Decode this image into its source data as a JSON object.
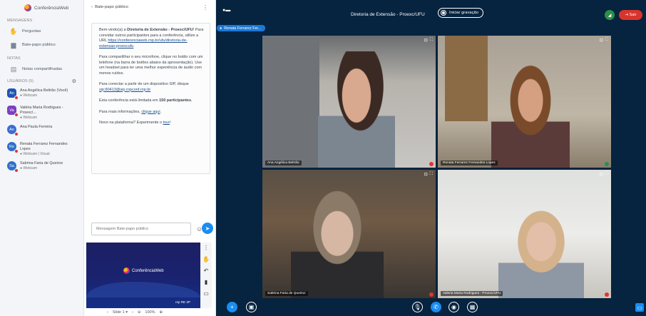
{
  "brand": {
    "name": "ConferênciaWeb"
  },
  "sidebar": {
    "messages_title": "MENSAGENS",
    "items": [
      {
        "label": "Perguntas",
        "icon": "hand-icon"
      },
      {
        "label": "Bate-papo público",
        "icon": "chat-icon"
      }
    ],
    "notes_title": "NOTAS",
    "notes_item": "Notas compartilhadas",
    "users_title": "USUÁRIOS (5)",
    "users": [
      {
        "initials": "An",
        "name": "Ana Angélica Beltrão (Você)",
        "status": "● Webcam",
        "color": "#1f55b4",
        "shape": "square"
      },
      {
        "initials": "Va",
        "name": "Valéria Maria Rodrigues - Proexc/...",
        "status": "● Webcam",
        "color": "#7b3fc1",
        "shape": "square"
      },
      {
        "initials": "An",
        "name": "Ana Paula Ferreira",
        "status": "",
        "color": "#3b6bd1",
        "shape": "round"
      },
      {
        "initials": "Re",
        "name": "Renata Ferrarez Fernandes Lopes",
        "status": "● Webcam | Visual",
        "color": "#2f6fc9",
        "shape": "round"
      },
      {
        "initials": "Sa",
        "name": "Sabrina Faria de Queiroz",
        "status": "● Webcam",
        "color": "#2f6fc9",
        "shape": "round"
      }
    ]
  },
  "chat": {
    "title": "Bate-papo público",
    "p1_a": "Bem-vindo(a) a ",
    "p1_b": "Diretoria de Extensão - Proexc/UFU",
    "p1_c": "! Para convidar outros participantes para a conferência, utilize a URL",
    "p1_link": "https://conferenciaweb.rnp.br/ufu/diretoria-de-extensao-proexcufu",
    "p2": "Para compartilhar o seu microfone, clique no botão com um telefone (na barra de botões abaixo da apresentação). Use um headset para ter uma melhor experiência de áudio com menos ruídos.",
    "p3_a": "Para conectar a partir de um dispositivo SIP, disque ",
    "p3_link": "sip:80413@sip.rnpconf.rnp.br",
    "p4_a": "Esta conferência está limitada em ",
    "p4_b": "150 participantes",
    "p4_c": ".",
    "p5_a": "Para mais informações, ",
    "p5_link": "clique aqui",
    "p5_c": ".",
    "p6_a": "Novo na plataforma? Experimente o ",
    "p6_link": "tour",
    "p6_c": "!",
    "input_placeholder": "Mensagem Bate-papo público"
  },
  "presentation": {
    "slide_logo_text": "ConferênciaWeb",
    "slide_footer": "rnp   RE·2P",
    "slide_label": "Slide 1",
    "zoom": "100%"
  },
  "main": {
    "conference_title": "Diretoria de Extensão - Proexc/UFU",
    "record_label": "Iniciar gravação",
    "leave_label": "Sair",
    "presenter": "Renata Ferrarez Fer...",
    "tiles": [
      {
        "name": "Ana Angélica Beltrão"
      },
      {
        "name": "Renata Ferrarez Fernandes Lopes"
      },
      {
        "name": "Sabrina Faria de Queiroz"
      },
      {
        "name": "Valeria Maria Rodrigues - Proexc/UFU"
      }
    ]
  },
  "colors": {
    "accent": "#1a8df0",
    "dark_bg": "#06233f",
    "danger": "#d9342c"
  }
}
